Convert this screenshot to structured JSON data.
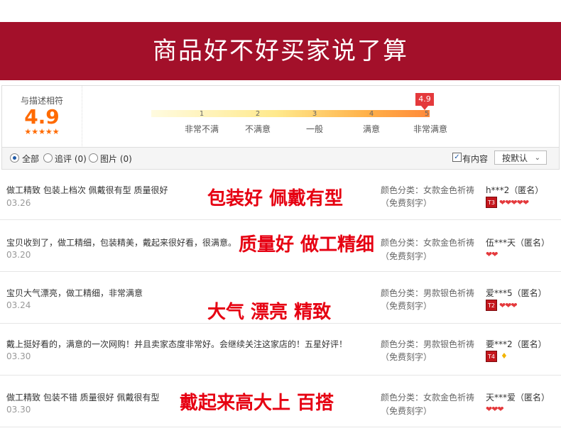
{
  "banner": {
    "title": "商品好不好买家说了算"
  },
  "rating": {
    "label": "与描述相符",
    "score": "4.9",
    "stars": "★★★★★",
    "badge": "4.9",
    "ticks": [
      "1",
      "2",
      "3",
      "4",
      "5"
    ],
    "levels": [
      "非常不满",
      "不满意",
      "一般",
      "满意",
      "非常满意"
    ]
  },
  "filter": {
    "all": "全部",
    "append": "追评 (0)",
    "pic": "图片 (0)",
    "has_content": "有内容",
    "check_mark": "✓",
    "sort": "按默认",
    "sort_chev": "⌄"
  },
  "reviews": [
    {
      "text": "做工精致 包装上档次 佩戴很有型 质量很好",
      "date": "03.26",
      "highlight": "包装好 佩戴有型",
      "sku": "颜色分类：女款金色祈祷",
      "sku2": "（免费刻字）",
      "user": "h***2（匿名）",
      "level": "T3",
      "hearts": "❤❤❤❤❤"
    },
    {
      "text": "宝贝收到了，做工精细，包装精美，戴起来很好看，很满意。",
      "date": "03.20",
      "highlight": "质量好 做工精细",
      "sku": "颜色分类：女款金色祈祷",
      "sku2": "（免费刻字）",
      "user": "伍***天（匿名）",
      "level": "",
      "hearts": "❤❤"
    },
    {
      "text": "宝贝大气漂亮，做工精细，非常满意",
      "date": "03.24",
      "highlight": "大气  漂亮  精致",
      "sku": "颜色分类：男款银色祈祷",
      "sku2": "（免费刻字）",
      "user": "爱***5（匿名）",
      "level": "T2",
      "hearts": "❤❤❤"
    },
    {
      "text": "戴上挺好看的，满意的一次网购！并且卖家态度非常好。会继续关注这家店的！五星好评！",
      "date": "03.30",
      "highlight": "",
      "sku": "颜色分类：男款银色祈祷",
      "sku2": "（免费刻字）",
      "user": "要***2（匿名）",
      "level": "T4",
      "hearts": "",
      "diamond": "♦"
    },
    {
      "text": "做工精致 包装不错 质量很好 佩戴很有型",
      "date": "03.30",
      "highlight": "戴起来高大上  百搭",
      "sku": "颜色分类：女款金色祈祷",
      "sku2": "（免费刻字）",
      "user": "天***爱（匿名）",
      "level": "",
      "hearts": "❤❤❤"
    }
  ]
}
